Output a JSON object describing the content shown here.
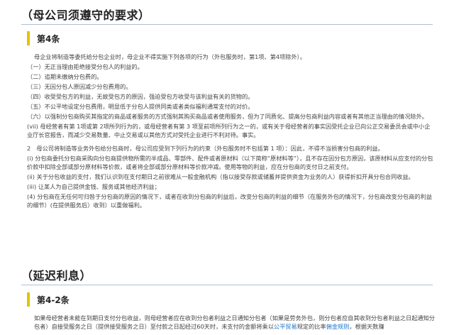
{
  "section1": {
    "heading": "（母公司须遵守的要求）",
    "article": {
      "title": "第4条"
    },
    "intro": "母企业将制造等委托给分包企业时，母企业不得实施下列各项的行为（外包服务时，第1项、第4项除外）。",
    "items": [
      "（一）无正当理由拒绝接受分包人的利益的。",
      "（二）追期未缴纳分包费的。",
      "（三）无因分包人原因减少分包费用的。",
      "（四）收受受包方的利益，无故受包方的原因，强迫受包方收受与该利益有关的货物的。",
      "（五）不公平地设定分包费用，明显低于分包人提供同类或者类似福利通常支付的对价。",
      "（六）以强制分包商购买其指定的商品或者服务的方式强制其购买商品或者使用服务，但为了同质化、提高分包商利益内容或者有其他正当理由的情况除外。",
      "(vii) 母经营者有第 1项或第 2项所列行为的，或母经营者有第 3 项至前项所列行为之一的，或有关于母经营者的事实因受托企业已向公正交易委员会或中小企业厅长官报告，而减少交易数量、中止交易或以其他方式对受托企业进行不利对待。事实。"
    ],
    "para2": "2　母公司将制造等业务外包给分包商时，母公司应受到下列行为的约束（外包服务时不包括第 1 项）：因此，不得不当损害分包商的利益。",
    "subitems": [
      "(i) 分包商委托分包商采购向分包商提供物所需的半成品、零部件、配件或者原材料（以下简称“原材料等”），且不存在因分包方原因，该原材料从应支付的分包价款中扣除全部或部分原材料等价款，或者将全部或部分原材料等价款冲减。使用等物的利益，应在分包商的支付日之前支付。",
      "(ii) 关于分包收益的支付，我们认识到在支付期日之前很难从一般金融机构（指以接受存款或储蓄并提供资金为业务的人）获得折扣开具分包合同收益。",
      "(iii) 让某人为自己提供金钱、服务或其他经济利益；",
      "(4) 分包商在无任何可归咎于分包商的原因的情况下，或者在收到分包商的利益后，改变分包商的利益的细节（在服务外包的情况下，分包商改变分包商的利益的细节）(在提供服务后）收到）以重做福利。"
    ]
  },
  "section2": {
    "heading": "（延迟利息）",
    "article": {
      "title": "第4-2条"
    },
    "text_before": "如果母经营者未能在到期日支付分包收益，则母经营者应在收到分包者利益之日通知分包者（如果是劳务外包，则分包者应自其收到分包者利益之日起通知分包者）自接受服务之日（提供接受服务之日）至付款之日起经过60天时，未支付的金额将乘以",
    "link1": "公平贸易",
    "text_middle": "规定的比率",
    "link2": "佣金规则",
    "text_after": "，根据天数赚"
  }
}
